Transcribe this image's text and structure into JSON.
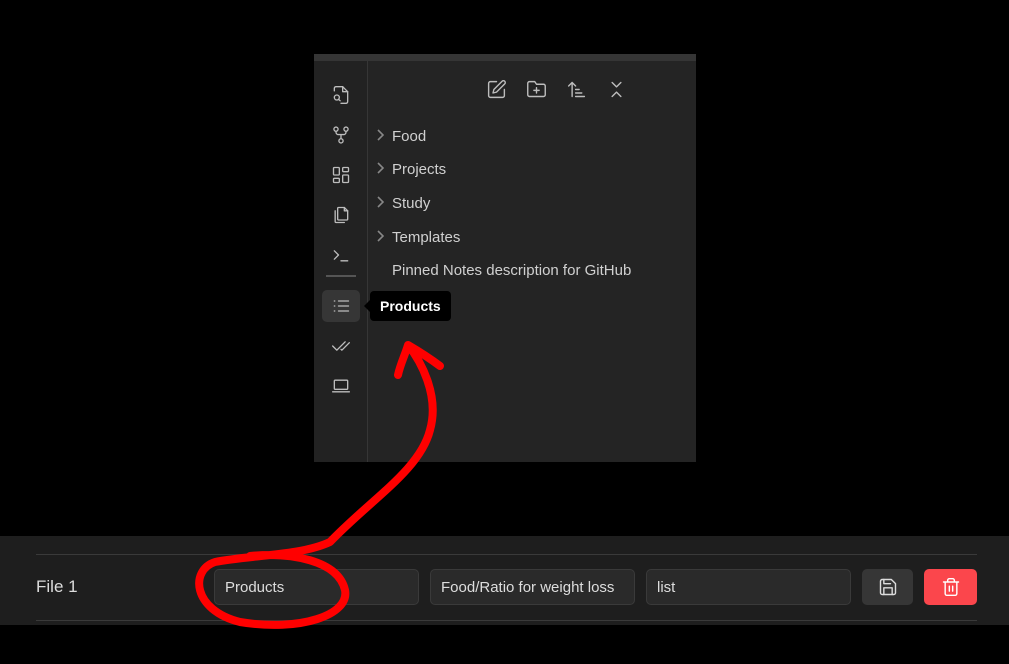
{
  "sidebar": {
    "ribbon": [
      {
        "icon": "file-search-icon"
      },
      {
        "icon": "git-fork-icon"
      },
      {
        "icon": "layout-dashboard-icon"
      },
      {
        "icon": "copy-icon"
      },
      {
        "icon": "terminal-icon"
      },
      {
        "icon": "list-icon",
        "active": true
      },
      {
        "icon": "check-check-icon"
      },
      {
        "icon": "laptop-icon"
      }
    ],
    "tooltip": "Products",
    "toolbar": [
      "new-note-icon",
      "new-folder-icon",
      "sort-icon",
      "collapse-all-icon"
    ],
    "tree": [
      {
        "label": "Food",
        "folder": true
      },
      {
        "label": "Projects",
        "folder": true
      },
      {
        "label": "Study",
        "folder": true
      },
      {
        "label": "Templates",
        "folder": true
      },
      {
        "label": "Pinned Notes description for GitHub",
        "folder": false
      }
    ]
  },
  "settings_row": {
    "label": "File 1",
    "name_value": "Products",
    "path_value": "Food/Ratio for weight loss",
    "icon_value": "list",
    "save_icon": "save-icon",
    "delete_icon": "trash-icon",
    "delete_color": "#fb464c"
  },
  "annotation_color": "#ff0000"
}
